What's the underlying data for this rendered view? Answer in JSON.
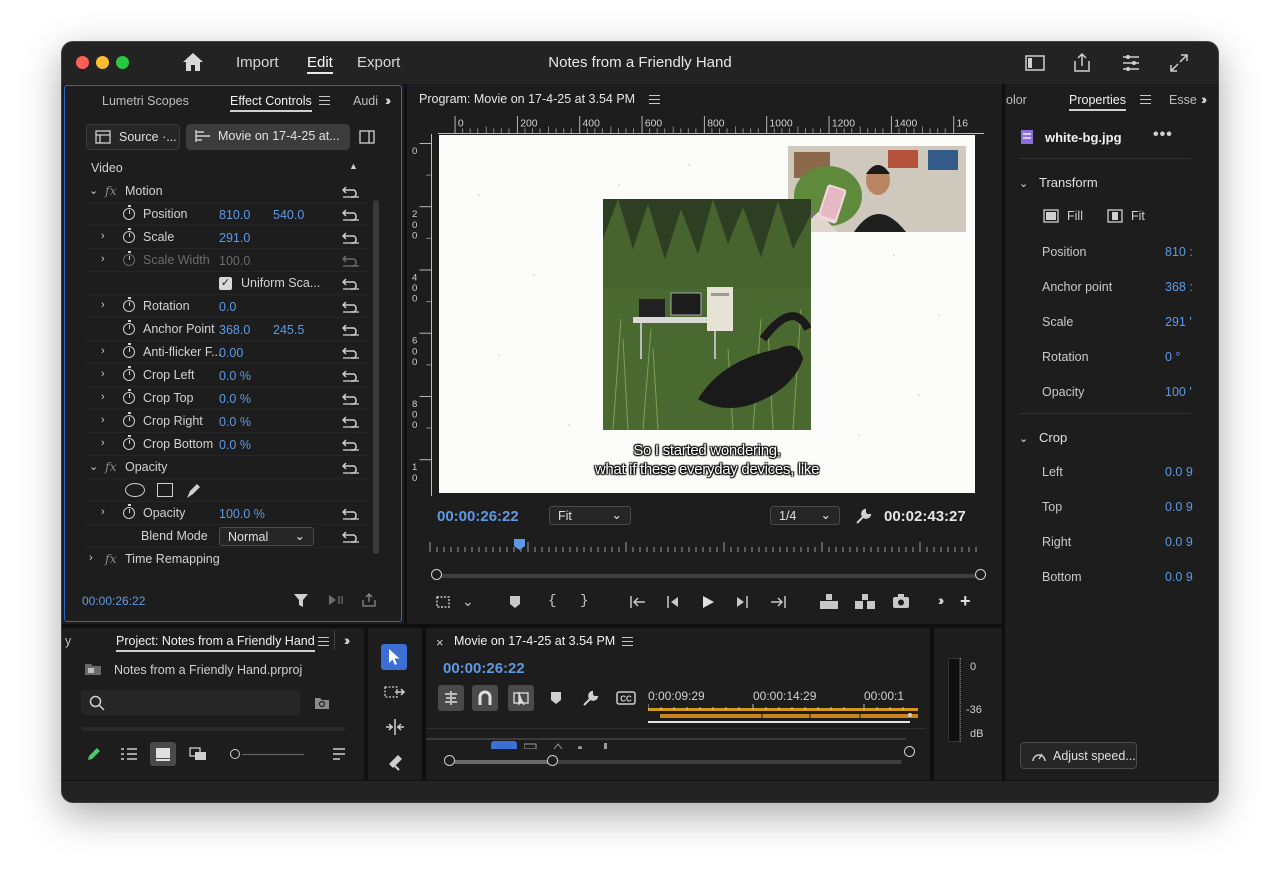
{
  "app": {
    "title": "Notes from a Friendly Hand",
    "nav": [
      "Import",
      "Edit",
      "Export"
    ],
    "active_nav": "Edit"
  },
  "effect_controls": {
    "tabs": [
      "Lumetri Scopes",
      "Effect Controls",
      "Audi"
    ],
    "source_tab": "Source ·...",
    "clip_tab": "Movie on 17-4-25 at...",
    "section": "Video",
    "motion_label": "Motion",
    "params": [
      {
        "name": "Position",
        "v1": "810.0",
        "v2": "540.0"
      },
      {
        "name": "Scale",
        "v1": "291.0",
        "v2": ""
      },
      {
        "name": "Scale Width",
        "v1": "100.0",
        "v2": ""
      },
      {
        "name": "Uniform Sca...",
        "v1": "",
        "v2": ""
      },
      {
        "name": "Rotation",
        "v1": "0.0",
        "v2": ""
      },
      {
        "name": "Anchor Point",
        "v1": "368.0",
        "v2": "245.5"
      },
      {
        "name": "Anti-flicker F...",
        "v1": "0.00",
        "v2": ""
      },
      {
        "name": "Crop Left",
        "v1": "0.0 %",
        "v2": ""
      },
      {
        "name": "Crop Top",
        "v1": "0.0 %",
        "v2": ""
      },
      {
        "name": "Crop Right",
        "v1": "0.0 %",
        "v2": ""
      },
      {
        "name": "Crop Bottom",
        "v1": "0.0 %",
        "v2": ""
      }
    ],
    "opacity_label": "Opacity",
    "opacity_param": {
      "name": "Opacity",
      "value": "100.0 %"
    },
    "blend_mode_label": "Blend Mode",
    "blend_mode_value": "Normal",
    "time_remap_label": "Time Remapping",
    "timecode": "00:00:26:22"
  },
  "program": {
    "title": "Program: Movie on 17-4-25 at 3.54 PM",
    "ruler_ticks": [
      "0",
      "200",
      "400",
      "600",
      "800",
      "1000",
      "1200",
      "1400",
      "16"
    ],
    "vruler_ticks": [
      "0",
      "2\n0\n0",
      "4\n0\n0",
      "6\n0\n0",
      "8\n0\n0",
      "1\n0"
    ],
    "subtitle_line1": "So I started wondering,",
    "subtitle_line2": "what if these everyday devices, like",
    "timecode": "00:00:26:22",
    "fit": "Fit",
    "resolution": "1/4",
    "duration": "00:02:43:27"
  },
  "properties": {
    "tabs": [
      "olor",
      "Properties",
      "Esse"
    ],
    "file": "white-bg.jpg",
    "transform_label": "Transform",
    "fill": "Fill",
    "fit": "Fit",
    "rows": [
      {
        "name": "Position",
        "value": "810 :"
      },
      {
        "name": "Anchor point",
        "value": "368 :"
      },
      {
        "name": "Scale",
        "value": "291 '"
      },
      {
        "name": "Rotation",
        "value": "0 °"
      },
      {
        "name": "Opacity",
        "value": "100 '"
      }
    ],
    "crop_label": "Crop",
    "crop_rows": [
      {
        "name": "Left",
        "value": "0.0 9"
      },
      {
        "name": "Top",
        "value": "0.0 9"
      },
      {
        "name": "Right",
        "value": "0.0 9"
      },
      {
        "name": "Bottom",
        "value": "0.0 9"
      }
    ],
    "adjust_speed": "Adjust speed..."
  },
  "project": {
    "left_tab": "y",
    "tab": "Project: Notes from a Friendly Hand",
    "file": "Notes from a Friendly Hand.prproj",
    "search_placeholder": ""
  },
  "timeline": {
    "tab": "Movie on 17-4-25 at 3.54 PM",
    "timecode": "00:00:26:22",
    "ticks": [
      "0:00:09:29",
      "00:00:14:29",
      "00:00:1"
    ]
  },
  "meter": {
    "labels": [
      "0",
      "-36",
      "dB"
    ]
  },
  "colors": {
    "accent_blue": "#5d9ae6",
    "panel_focus": "#2f64c7",
    "timeline_clip": "#d49a1e"
  }
}
